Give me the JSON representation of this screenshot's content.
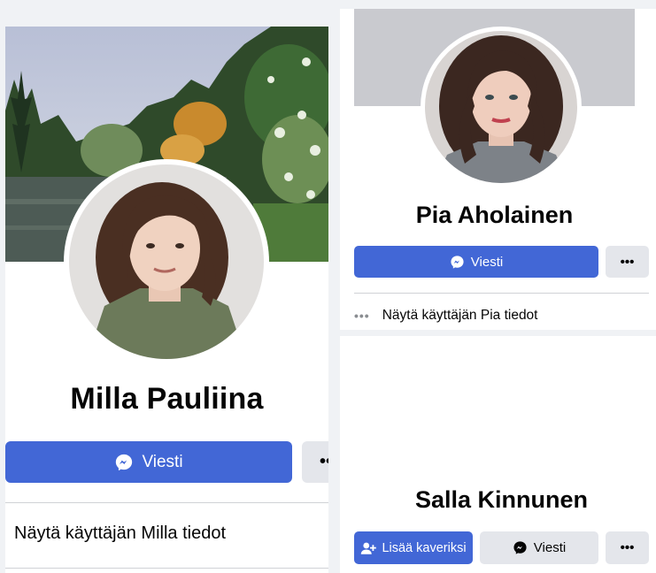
{
  "profiles": {
    "milla": {
      "name": "Milla Pauliina",
      "message_label": "Viesti",
      "more_label": "•••",
      "info_text": "Näytä käyttäjän Milla tiedot"
    },
    "pia": {
      "name": "Pia Aholainen",
      "message_label": "Viesti",
      "more_label": "•••",
      "info_dots": "•••",
      "info_text": "Näytä käyttäjän Pia tiedot"
    },
    "salla": {
      "name": "Salla Kinnunen",
      "add_friend_label": "Lisää kaveriksi",
      "message_label": "Viesti",
      "more_label": "•••"
    }
  },
  "icons": {
    "messenger": "messenger-icon",
    "add_friend": "add-friend-icon",
    "more": "more-icon"
  },
  "colors": {
    "primary_button": "#4267d6",
    "secondary_button": "#e4e6eb",
    "cover_placeholder": "#c9cacf"
  }
}
